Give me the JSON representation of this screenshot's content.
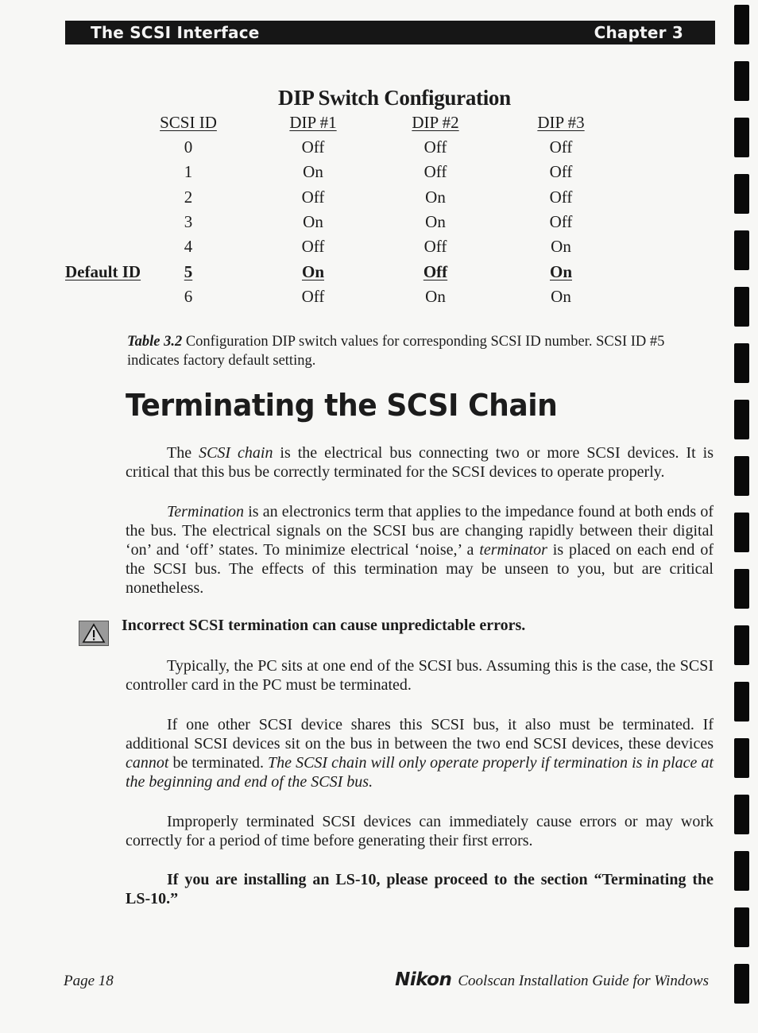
{
  "header": {
    "section": "The SCSI Interface",
    "chapter": "Chapter 3"
  },
  "dip_table": {
    "title": "DIP Switch Configuration",
    "columns": [
      "SCSI ID",
      "DIP #1",
      "DIP #2",
      "DIP #3"
    ],
    "rows": [
      {
        "label": "",
        "id": "0",
        "dip1": "Off",
        "dip2": "Off",
        "dip3": "Off"
      },
      {
        "label": "",
        "id": "1",
        "dip1": "On",
        "dip2": "Off",
        "dip3": "Off"
      },
      {
        "label": "",
        "id": "2",
        "dip1": "Off",
        "dip2": "On",
        "dip3": "Off"
      },
      {
        "label": "",
        "id": "3",
        "dip1": "On",
        "dip2": "On",
        "dip3": "Off"
      },
      {
        "label": "",
        "id": "4",
        "dip1": "Off",
        "dip2": "Off",
        "dip3": "On"
      },
      {
        "label": "Default ID",
        "id": "5",
        "dip1": "On",
        "dip2": "Off",
        "dip3": "On"
      },
      {
        "label": "",
        "id": "6",
        "dip1": "Off",
        "dip2": "On",
        "dip3": "On"
      }
    ],
    "default_row_index": 5
  },
  "caption": {
    "label": "Table 3.2",
    "text": " Configuration DIP switch values for corresponding SCSI ID number.  SCSI ID #5 indicates factory default setting."
  },
  "section_title": "Terminating the SCSI Chain",
  "paragraphs": {
    "p1": {
      "a": "The ",
      "b_italic": "SCSI chain",
      "c": " is the electrical bus connecting two or more SCSI devices.  It is critical that this bus be correctly terminated for the SCSI devices to operate properly."
    },
    "p2": {
      "a_italic": "Termination",
      "b": " is an electronics term that applies to the impedance found at both ends of the bus.  The electrical signals on the SCSI bus are changing rapidly between their digital ‘on’ and ‘off’ states.  To minimize electrical ‘noise,’ a ",
      "c_italic": "terminator",
      "d": " is placed on each end of the SCSI bus.  The effects of this termination may be unseen to you, but are critical nonetheless."
    },
    "warning": "Incorrect SCSI termination can cause unpredictable errors.",
    "p3": "Typically, the PC sits at one end of the SCSI bus.  Assuming this is the case, the SCSI controller card in the PC must be terminated.",
    "p4": {
      "a": "If one other SCSI device shares this SCSI bus, it also must be terminated.  If additional SCSI devices sit on the bus in between the two end SCSI devices, these devices ",
      "b_italic": "cannot",
      "c": " be terminated.  ",
      "d_italic": "The SCSI chain will only operate properly if termination is in place at the beginning and end of the SCSI bus."
    },
    "p5": "Improperly terminated SCSI devices can immediately cause errors or may work correctly for a period of time before generating their first errors.",
    "p6_bold": "If you are installing an LS-10, please proceed to the section “Terminating the LS-10.”"
  },
  "footer": {
    "page": "Page 18",
    "brand": "Nikon",
    "guide": "Coolscan Installation Guide for Windows"
  },
  "icons": {
    "warning": "warning-triangle-icon"
  }
}
